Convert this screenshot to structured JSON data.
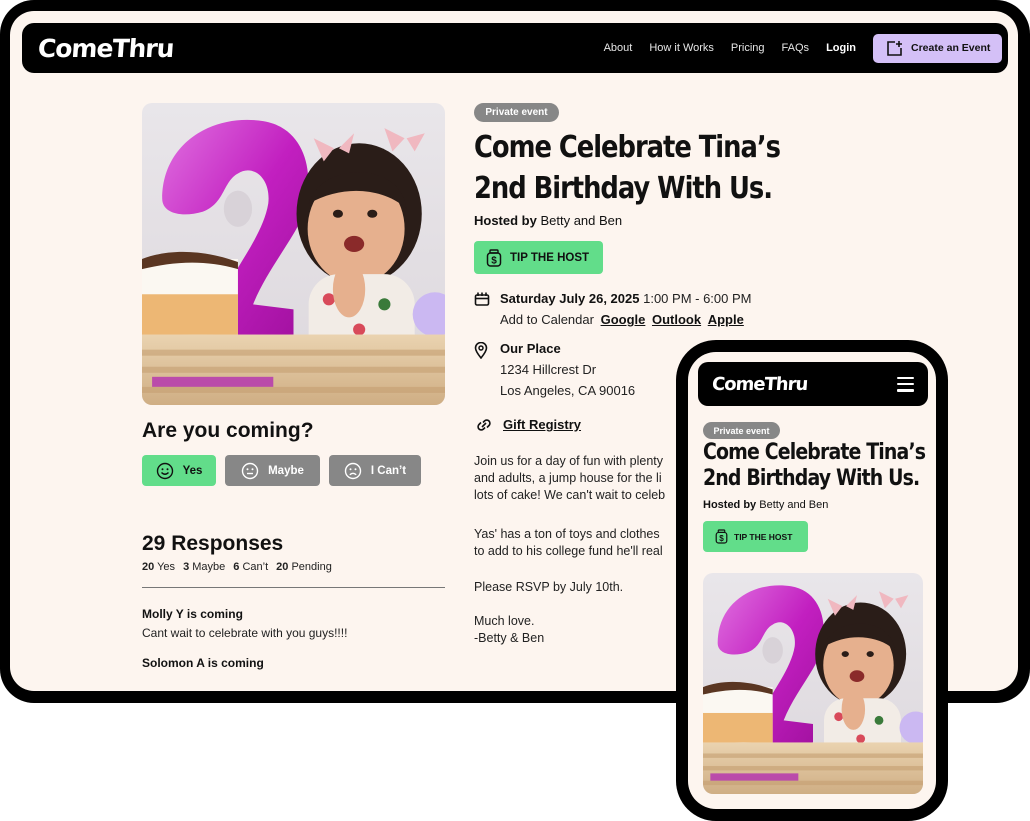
{
  "brand": {
    "logo": "ComeThru",
    "accent_purple": "#d4c0f7",
    "accent_green": "#62dd8a",
    "badge_gray": "#878787",
    "page_bg": "#fdf5ef"
  },
  "nav": {
    "links": [
      "About",
      "How it Works",
      "Pricing",
      "FAQs"
    ],
    "login": "Login",
    "create_event": "Create an Event",
    "create_icon": "add-square-icon"
  },
  "event": {
    "badge": "Private event",
    "title_line1": "Come Celebrate Tina’s",
    "title_line2": "2nd Birthday With Us.",
    "hosted_label": "Hosted by",
    "hosts": "Betty and Ben",
    "tip_button": "TIP THE HOST",
    "date_bold": "Saturday July 26, 2025",
    "time": "1:00 PM - 6:00 PM",
    "add_to_calendar": "Add to Calendar",
    "calendar_links": [
      "Google",
      "Outlook",
      "Apple"
    ],
    "place_name": "Our Place",
    "address_line1": "1234 Hillcrest Dr",
    "address_line2": "Los Angeles, CA 90016",
    "gift_registry": "Gift Registry",
    "description": [
      "Join us for a day of fun with plenty",
      "and adults, a jump house for the li",
      "lots of cake! We can't wait to celeb"
    ],
    "description2": [
      "Yas' has a ton of toys and clothes",
      "to add to his college fund he'll real"
    ],
    "rsvp_by": "Please RSVP by July 10th.",
    "signoff1": "Much love.",
    "signoff2": "-Betty & Ben",
    "image_alt": "Toddler clapping next to a pink number 2 balloon and birthday cake"
  },
  "rsvp": {
    "question": "Are you coming?",
    "options": [
      {
        "label": "Yes",
        "icon": "smile-icon",
        "selected": true
      },
      {
        "label": "Maybe",
        "icon": "neutral-face-icon",
        "selected": false
      },
      {
        "label": "I Can’t",
        "icon": "sad-face-icon",
        "selected": false
      }
    ]
  },
  "responses": {
    "title": "29 Responses",
    "counts": [
      {
        "num": "20",
        "label": "Yes"
      },
      {
        "num": "3",
        "label": "Maybe"
      },
      {
        "num": "6",
        "label": "Can’t"
      },
      {
        "num": "20",
        "label": "Pending"
      }
    ],
    "items": [
      {
        "name": "Molly Y  is coming",
        "message": "Cant wait to celebrate with you guys!!!!"
      },
      {
        "name": "Solomon A  is coming",
        "message": ""
      }
    ]
  },
  "phone": {
    "logo": "ComeThru",
    "menu_icon": "hamburger-menu-icon",
    "badge": "Private event",
    "title_line1": "Come Celebrate Tina’s",
    "title_line2": "2nd Birthday With Us.",
    "hosted_label": "Hosted by",
    "hosts": "Betty and Ben",
    "tip_button": "TIP THE HOST"
  }
}
